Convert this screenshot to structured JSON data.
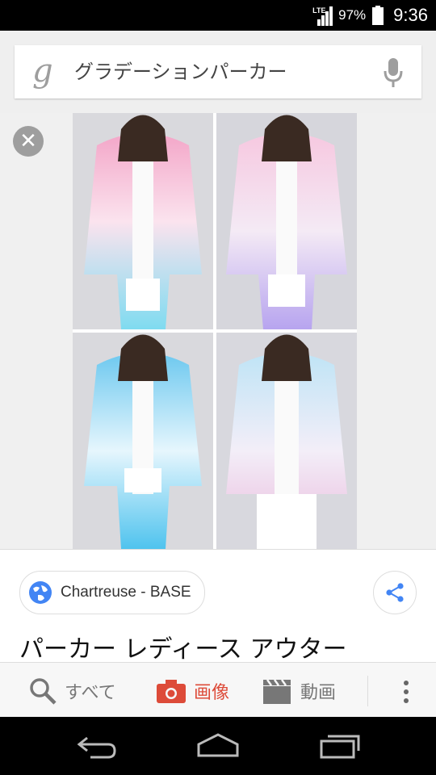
{
  "status_bar": {
    "network": "LTE",
    "battery_percent": "97%",
    "battery_level": 0.97,
    "time": "9:36"
  },
  "search": {
    "logo_glyph": "g",
    "query": "グラデーションパーカー"
  },
  "image_viewer": {
    "close_glyph": "✕",
    "photo": {
      "description_icon": "product-collage-image",
      "tiles": [
        {
          "top_color": "#f3a6c8",
          "bottom_color": "#7fdbf0"
        },
        {
          "top_color": "#f6c8e0",
          "bottom_color": "#b7a4ef"
        },
        {
          "top_color": "#6cc8ef",
          "bottom_color": "#4fc3ee"
        },
        {
          "top_color": "#bfe4f6",
          "bottom_color": "#e9b6da"
        }
      ]
    }
  },
  "result": {
    "source_label": "Chartreuse - BASE",
    "title": "パーカー レディース アウター"
  },
  "tabs": [
    {
      "label": "すべて",
      "icon": "search-icon",
      "active": false
    },
    {
      "label": "画像",
      "icon": "camera-icon",
      "active": true
    },
    {
      "label": "動画",
      "icon": "clapperboard-icon",
      "active": false
    }
  ],
  "colors": {
    "accent": "#dd4b39",
    "share_blue": "#4285f4"
  }
}
